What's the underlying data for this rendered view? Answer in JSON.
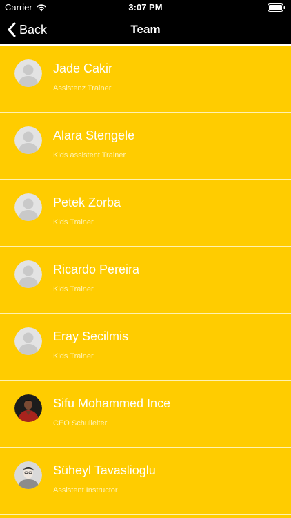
{
  "status_bar": {
    "carrier": "Carrier",
    "time": "3:07 PM",
    "wifi_icon": "wifi-icon",
    "battery_icon": "battery-icon"
  },
  "nav": {
    "back_label": "Back",
    "title": "Team"
  },
  "colors": {
    "list_background": "#ffcc00",
    "nav_background": "#000000",
    "text": "#ffffff"
  },
  "members": [
    {
      "name": "Jade Cakir",
      "role": "Assistenz Trainer",
      "avatar": "placeholder"
    },
    {
      "name": "Alara Stengele",
      "role": "Kids assistent Trainer",
      "avatar": "placeholder"
    },
    {
      "name": "Petek Zorba",
      "role": "Kids Trainer",
      "avatar": "placeholder"
    },
    {
      "name": "Ricardo Pereira",
      "role": "Kids Trainer",
      "avatar": "placeholder"
    },
    {
      "name": "Eray Secilmis",
      "role": "Kids Trainer",
      "avatar": "placeholder"
    },
    {
      "name": "Sifu Mohammed Ince",
      "role": "CEO Schulleiter",
      "avatar": "photo-dark"
    },
    {
      "name": "Süheyl Tavaslioglu",
      "role": "Assistent Instructor",
      "avatar": "photo-light"
    }
  ]
}
